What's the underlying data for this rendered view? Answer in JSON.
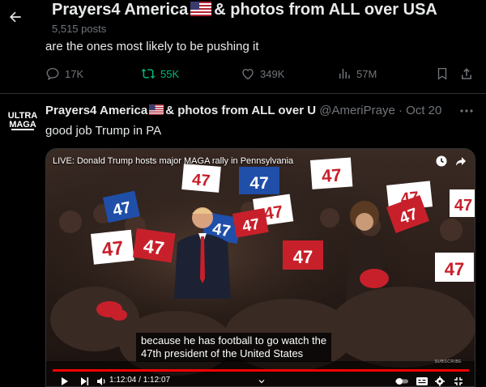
{
  "header": {
    "title_prefix": "Prayers4 America",
    "title_suffix": "& photos from ALL over USA",
    "post_count": "5,515 posts"
  },
  "previous_tweet": {
    "text": "are the ones most likely to be pushing it",
    "replies": "17K",
    "reposts": "55K",
    "likes": "349K",
    "views": "57M"
  },
  "tweet": {
    "avatar_text_top": "ULTRA",
    "avatar_text_bottom": "MAGA",
    "author_prefix": "Prayers4 America",
    "author_suffix": "& photos from ALL over U",
    "handle": "@AmeriPraye",
    "separator": "·",
    "date": "Oct 20",
    "text": "good job Trump in PA"
  },
  "video": {
    "title": "LIVE: Donald Trump hosts major MAGA rally in Pennsylvania",
    "caption_line1": "because he has football to go watch the",
    "caption_line2": "47th president of the United States",
    "time_display": "1:12:04 / 1:12:07",
    "progress_fraction": 0.9993,
    "watermark": "SUBSCRIBE",
    "sign_text": "47"
  },
  "colors": {
    "repost_green": "#00ba7c",
    "muted": "#71767b",
    "progress_red": "#ff0000",
    "sign_red": "#c8202b",
    "sign_blue": "#1f4fa8"
  }
}
